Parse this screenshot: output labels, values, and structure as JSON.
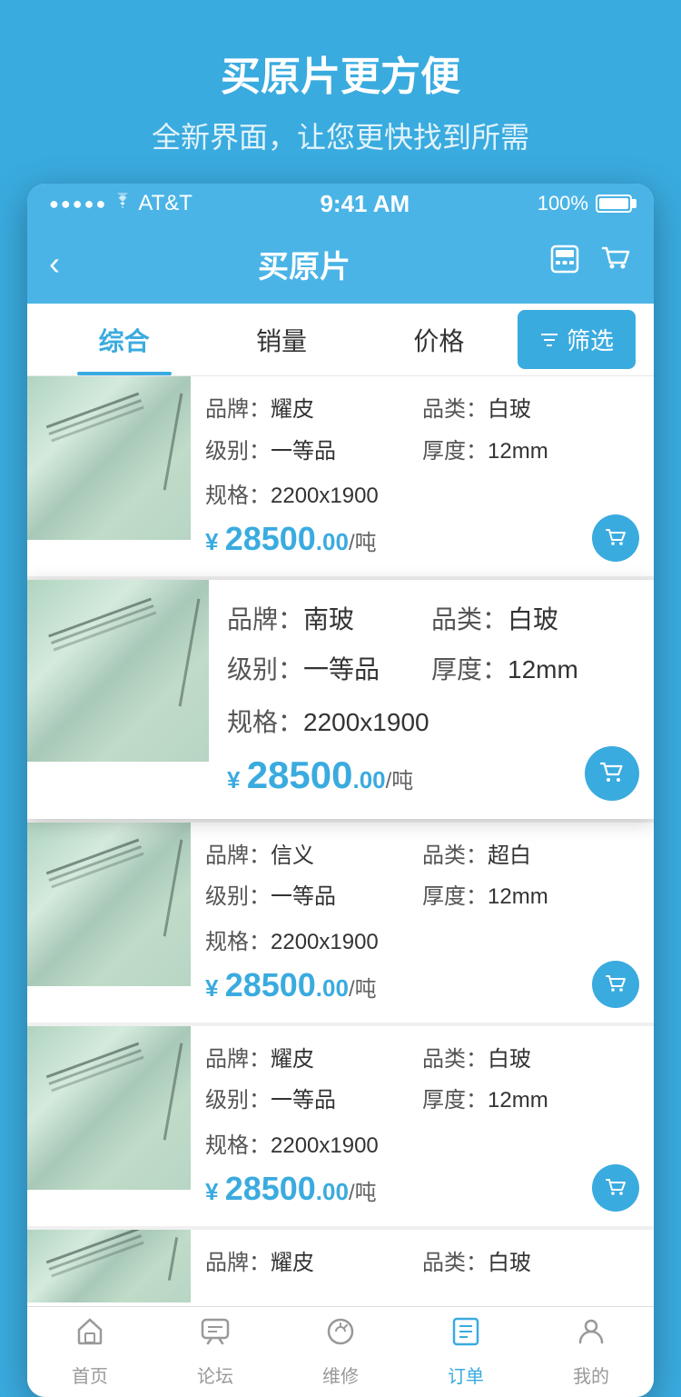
{
  "header": {
    "title": "买原片更方便",
    "subtitle": "全新界面，让您更快找到所需"
  },
  "statusBar": {
    "carrier": "AT&T",
    "time": "9:41 AM",
    "battery": "100%"
  },
  "navBar": {
    "backLabel": "‹",
    "title": "买原片",
    "calcIcon": "🧮",
    "cartIcon": "🛒"
  },
  "filterBar": {
    "tabs": [
      {
        "label": "综合",
        "active": true
      },
      {
        "label": "销量",
        "active": false
      },
      {
        "label": "价格",
        "active": false
      }
    ],
    "filterBtn": "筛选"
  },
  "products": [
    {
      "brand": "耀皮",
      "category": "白玻",
      "grade": "一等品",
      "thickness": "12mm",
      "spec": "2200x1900",
      "price": "28500",
      "priceDecimal": "00",
      "unit": "/吨",
      "highlighted": false
    },
    {
      "brand": "南玻",
      "category": "白玻",
      "grade": "一等品",
      "thickness": "12mm",
      "spec": "2200x1900",
      "price": "28500",
      "priceDecimal": "00",
      "unit": "/吨",
      "highlighted": true
    },
    {
      "brand": "信义",
      "category": "超白",
      "grade": "一等品",
      "thickness": "12mm",
      "spec": "2200x1900",
      "price": "28500",
      "priceDecimal": "00",
      "unit": "/吨",
      "highlighted": false
    },
    {
      "brand": "耀皮",
      "category": "白玻",
      "grade": "一等品",
      "thickness": "12mm",
      "spec": "2200x1900",
      "price": "28500",
      "priceDecimal": "00",
      "unit": "/吨",
      "highlighted": false
    },
    {
      "brand": "耀皮",
      "category": "白玻",
      "grade": "",
      "thickness": "",
      "spec": "",
      "price": "",
      "priceDecimal": "",
      "unit": "",
      "highlighted": false,
      "partial": true
    }
  ],
  "tabBar": {
    "items": [
      {
        "label": "首页",
        "icon": "home",
        "active": false
      },
      {
        "label": "论坛",
        "icon": "forum",
        "active": false
      },
      {
        "label": "维修",
        "icon": "repair",
        "active": false
      },
      {
        "label": "订单",
        "icon": "order",
        "active": true
      },
      {
        "label": "我的",
        "icon": "profile",
        "active": false
      }
    ]
  }
}
